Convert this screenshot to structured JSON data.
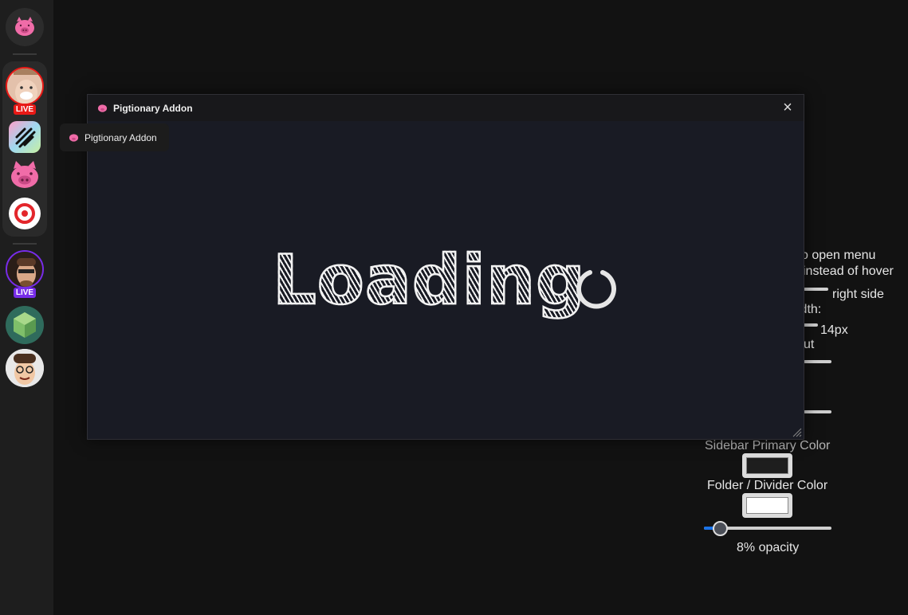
{
  "sidebar": {
    "live_label_1": "LIVE",
    "live_label_2": "LIVE",
    "colors": {
      "live_red": "#e91916",
      "live_purple": "#772ce8",
      "brand_pink": "#f06ca8"
    }
  },
  "tooltip": {
    "label": "Pigtionary Addon"
  },
  "modal": {
    "title": "Pigtionary Addon",
    "close_icon": "×",
    "loading_text": "Loading"
  },
  "settings": {
    "line1": "o open menu",
    "line2": "instead of hover",
    "line3": "right side",
    "line4": "idth:",
    "line5": "14px",
    "line6": "ut",
    "line7": "Sidebar Primary Color",
    "line8": "Folder / Divider Color",
    "opacity_label": "8% opacity",
    "opacity_value": 0.08
  }
}
